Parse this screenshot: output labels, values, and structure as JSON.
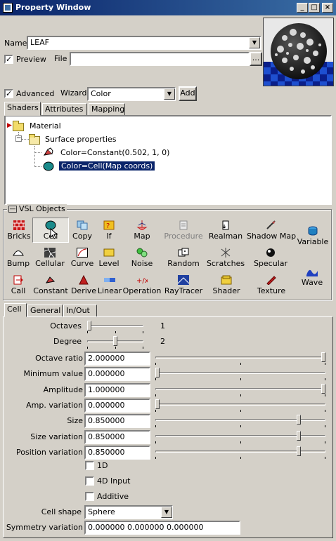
{
  "window": {
    "title": "Property Window",
    "minimize": "_",
    "maximize": "□",
    "close": "×"
  },
  "name_row": {
    "label": "Name",
    "value": "LEAF"
  },
  "preview_row": {
    "label": "Preview",
    "file_label": "File",
    "file_value": "",
    "browse_label": "...",
    "preview_checked": true
  },
  "wizard_row": {
    "advanced_label": "Advanced",
    "advanced_checked": true,
    "wizard_label": "Wizard",
    "wizard_value": "Color",
    "add_label": "Add"
  },
  "top_tabs": [
    "Shaders",
    "Attributes",
    "Mapping"
  ],
  "tree": {
    "material": "Material",
    "surface": "Surface properties",
    "color_constant": "Color=Constant(0.502, 1, 0)",
    "color_cell": "Color=Cell(Map coords)"
  },
  "vsl_group": {
    "label": "VSL Objects",
    "collapse": "—"
  },
  "tools": {
    "row1": [
      "Bricks",
      "Cell",
      "Copy",
      "If",
      "Map",
      "Procedure",
      "Realman",
      "Shadow Map",
      "Variable"
    ],
    "row2": [
      "Bump",
      "Cellular",
      "Curve",
      "Level",
      "Noise",
      "Random",
      "Scratches",
      "Specular"
    ],
    "row3": [
      "Call",
      "Constant",
      "Derive",
      "Linear",
      "Operation",
      "RayTracer",
      "Shader",
      "Texture",
      "Wave"
    ]
  },
  "bottom_tabs": [
    "Cell",
    "General",
    "In/Out"
  ],
  "params": {
    "octaves_label": "Octaves",
    "octaves_value": "1",
    "octaves_level": 0.0,
    "degree_label": "Degree",
    "degree_value": "2",
    "degree_level": 0.5,
    "rows": [
      {
        "label": "Octave ratio",
        "value": "2.000000",
        "level": 1.0
      },
      {
        "label": "Minimum value",
        "value": "0.000000",
        "level": 0.0
      },
      {
        "label": "Amplitude",
        "value": "1.000000",
        "level": 1.0
      },
      {
        "label": "Amp. variation",
        "value": "0.000000",
        "level": 0.0
      },
      {
        "label": "Size",
        "value": "0.850000",
        "level": 0.85
      },
      {
        "label": "Size variation",
        "value": "0.850000",
        "level": 0.85
      },
      {
        "label": "Position variation",
        "value": "0.850000",
        "level": 0.85
      }
    ],
    "check_1d": "1D",
    "check_4d": "4D Input",
    "check_additive": "Additive",
    "cell_shape_label": "Cell shape",
    "cell_shape_value": "Sphere",
    "symmetry_label": "Symmetry variation",
    "symmetry_value": "0.000000 0.000000 0.000000"
  },
  "colors": {
    "titlebar": "#0a246a",
    "selection": "#0a246a",
    "face": "#d4d0c8"
  }
}
